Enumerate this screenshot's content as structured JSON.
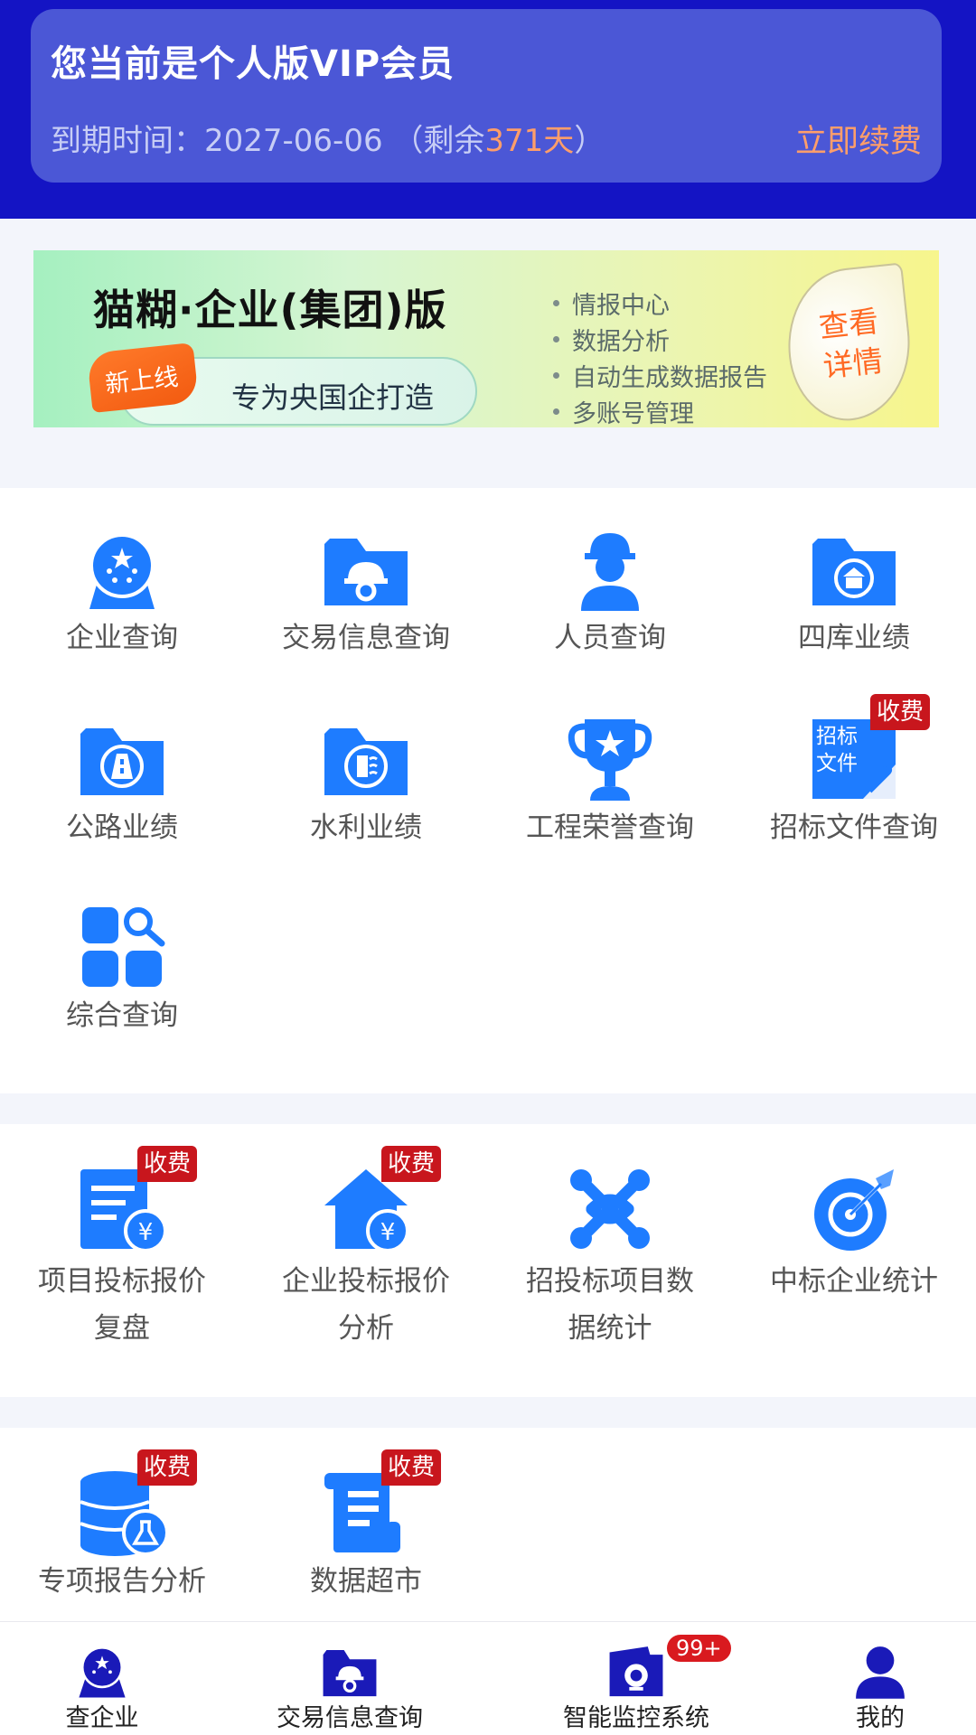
{
  "vip": {
    "title": "您当前是个人版VIP会员",
    "expire_prefix": "到期时间：2027-06-06 （剩余",
    "days_left": "371天",
    "expire_suffix": "）",
    "renew_label": "立即续费"
  },
  "banner": {
    "title": "猫糊·企业(集团)版",
    "new_tag": "新上线",
    "tagline": "专为央国企打造",
    "features": [
      "情报中心",
      "数据分析",
      "自动生成数据报告",
      "多账号管理"
    ],
    "detail_line1": "查看",
    "detail_line2": "详情"
  },
  "section1": {
    "items": [
      {
        "label": "企业查询",
        "icon": "enterprise-globe-icon"
      },
      {
        "label": "交易信息查询",
        "icon": "folder-helmet-icon"
      },
      {
        "label": "人员查询",
        "icon": "worker-icon"
      },
      {
        "label": "四库业绩",
        "icon": "folder-building-icon"
      },
      {
        "label": "公路业绩",
        "icon": "folder-road-icon"
      },
      {
        "label": "水利业绩",
        "icon": "folder-water-icon"
      },
      {
        "label": "工程荣誉查询",
        "icon": "trophy-icon"
      },
      {
        "label": "招标文件查询",
        "icon": "bid-document-icon",
        "badge": "收费",
        "icon_text_1": "招标",
        "icon_text_2": "文件"
      },
      {
        "label": "综合查询",
        "icon": "grid-search-icon"
      }
    ]
  },
  "section2": {
    "items": [
      {
        "label_1": "项目投标报价",
        "label_2": "复盘",
        "icon": "document-yuan-icon",
        "badge": "收费"
      },
      {
        "label_1": "企业投标报价",
        "label_2": "分析",
        "icon": "house-yuan-icon",
        "badge": "收费"
      },
      {
        "label_1": "招投标项目数",
        "label_2": "据统计",
        "icon": "joomla-network-icon"
      },
      {
        "label_1": "中标企业统计",
        "label_2": "",
        "icon": "target-dart-icon"
      }
    ]
  },
  "section3": {
    "items": [
      {
        "label": "专项报告分析",
        "icon": "database-flask-icon",
        "badge": "收费"
      },
      {
        "label": "数据超市",
        "icon": "scroll-document-icon",
        "badge": "收费"
      }
    ]
  },
  "nav": {
    "items": [
      {
        "label": "查企业",
        "icon": "enterprise-globe-icon"
      },
      {
        "label": "交易信息查询",
        "icon": "folder-helmet-icon"
      },
      {
        "label": "智能监控系统",
        "icon": "monitor-camera-icon",
        "badge": "99+"
      },
      {
        "label": "我的",
        "icon": "user-icon"
      }
    ]
  },
  "colors": {
    "header_bg": "#1414c4",
    "card_bg": "#4b57d6",
    "icon_blue": "#1e7cff",
    "nav_blue": "#1a1ab8",
    "accent_orange": "#ff9e6a",
    "badge_red": "#c8161d"
  }
}
